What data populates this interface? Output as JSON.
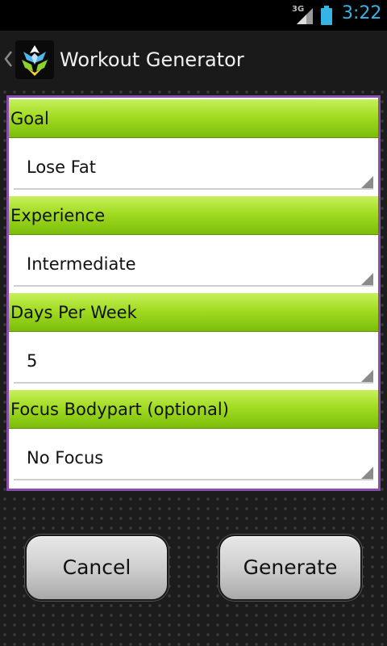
{
  "status_bar": {
    "network_type": "3G",
    "time": "3:22"
  },
  "action_bar": {
    "title": "Workout Generator"
  },
  "form": {
    "fields": [
      {
        "label": "Goal",
        "value": "Lose Fat"
      },
      {
        "label": "Experience",
        "value": "Intermediate"
      },
      {
        "label": "Days Per Week",
        "value": "5"
      },
      {
        "label": "Focus Bodypart (optional)",
        "value": "No Focus"
      }
    ]
  },
  "buttons": {
    "cancel": "Cancel",
    "generate": "Generate"
  },
  "colors": {
    "header_green": "#a2dc22",
    "card_border": "#8a4cb0",
    "clock_blue": "#33b5e5"
  }
}
